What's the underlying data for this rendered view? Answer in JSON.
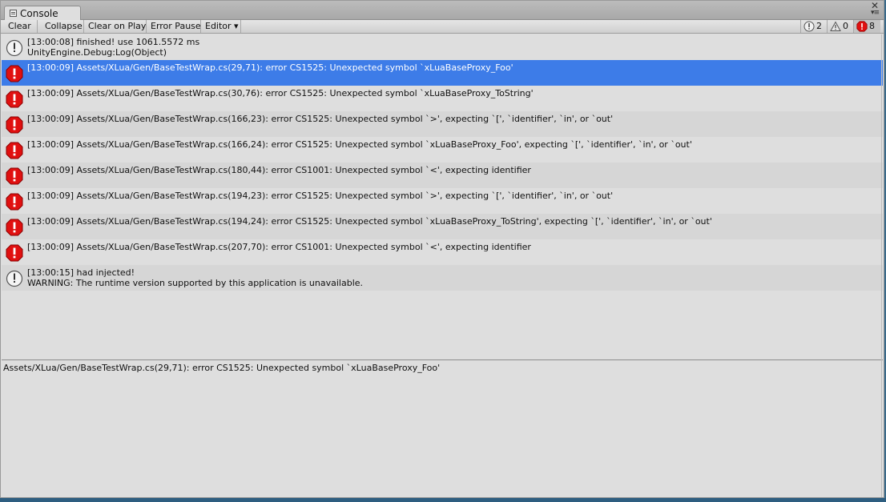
{
  "window": {
    "tab_title": "Console",
    "close_glyph": "✕",
    "menu_glyph": "▾≡"
  },
  "toolbar": {
    "clear_label": "Clear",
    "collapse_label": "Collapse",
    "clear_on_play_label": "Clear on Play",
    "error_pause_label": "Error Pause",
    "editor_label": "Editor ▾",
    "log_count": "2",
    "warning_count": "0",
    "error_count": "8"
  },
  "entries": [
    {
      "type": "info",
      "line1": "[13:00:08] finished! use 1061.5572 ms",
      "line2": "UnityEngine.Debug:Log(Object)"
    },
    {
      "type": "error",
      "line1": "[13:00:09] Assets/XLua/Gen/BaseTestWrap.cs(29,71): error CS1525: Unexpected symbol `xLuaBaseProxy_Foo'",
      "line2": ""
    },
    {
      "type": "error",
      "line1": "[13:00:09] Assets/XLua/Gen/BaseTestWrap.cs(30,76): error CS1525: Unexpected symbol `xLuaBaseProxy_ToString'",
      "line2": ""
    },
    {
      "type": "error",
      "line1": "[13:00:09] Assets/XLua/Gen/BaseTestWrap.cs(166,23): error CS1525: Unexpected symbol `>', expecting `[', `identifier', `in', or `out'",
      "line2": ""
    },
    {
      "type": "error",
      "line1": "[13:00:09] Assets/XLua/Gen/BaseTestWrap.cs(166,24): error CS1525: Unexpected symbol `xLuaBaseProxy_Foo', expecting `[', `identifier', `in', or `out'",
      "line2": ""
    },
    {
      "type": "error",
      "line1": "[13:00:09] Assets/XLua/Gen/BaseTestWrap.cs(180,44): error CS1001: Unexpected symbol `<', expecting identifier",
      "line2": ""
    },
    {
      "type": "error",
      "line1": "[13:00:09] Assets/XLua/Gen/BaseTestWrap.cs(194,23): error CS1525: Unexpected symbol `>', expecting `[', `identifier', `in', or `out'",
      "line2": ""
    },
    {
      "type": "error",
      "line1": "[13:00:09] Assets/XLua/Gen/BaseTestWrap.cs(194,24): error CS1525: Unexpected symbol `xLuaBaseProxy_ToString', expecting `[', `identifier', `in', or `out'",
      "line2": ""
    },
    {
      "type": "error",
      "line1": "[13:00:09] Assets/XLua/Gen/BaseTestWrap.cs(207,70): error CS1001: Unexpected symbol `<', expecting identifier",
      "line2": ""
    },
    {
      "type": "info",
      "line1": "[13:00:15] had injected!",
      "line2": "WARNING: The runtime version supported by this application is unavailable."
    }
  ],
  "selected_index": 1,
  "detail": {
    "text": "Assets/XLua/Gen/BaseTestWrap.cs(29,71): error CS1525: Unexpected symbol `xLuaBaseProxy_Foo'"
  },
  "colors": {
    "selection": "#3d7ce8",
    "error_red": "#e01010"
  }
}
